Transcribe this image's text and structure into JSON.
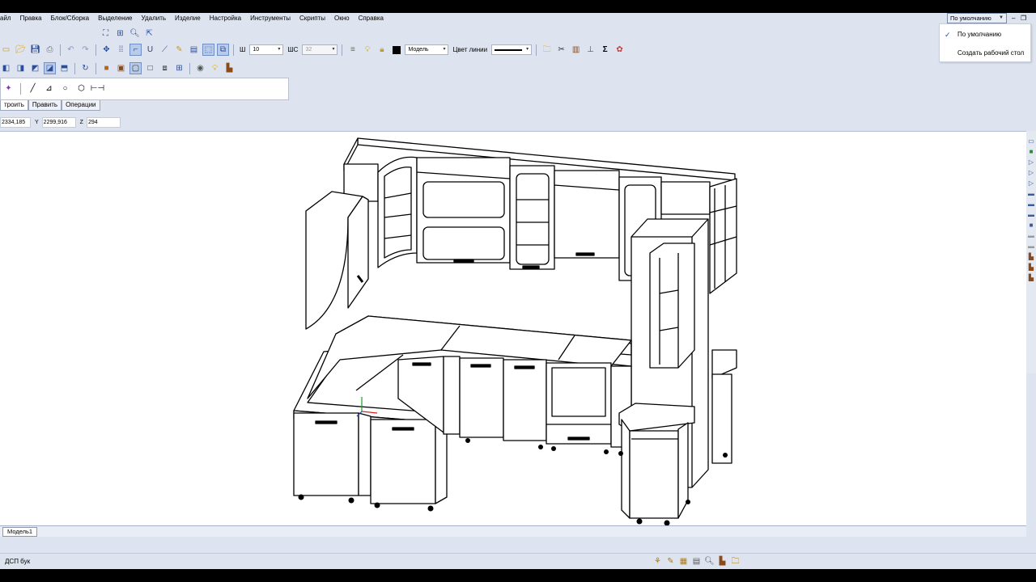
{
  "menu": [
    "айл",
    "Правка",
    "Блок/Сборка",
    "Выделение",
    "Удалить",
    "Изделие",
    "Настройка",
    "Инструменты",
    "Скрипты",
    "Окно",
    "Справка"
  ],
  "workspace": {
    "current": "По умолчанию",
    "options": [
      "По умолчанию",
      "Создать рабочий стол"
    ]
  },
  "window_controls": {
    "minimize": "–",
    "restore": "❐"
  },
  "toolbar": {
    "width_label": "Ш",
    "width_value": "10",
    "height_label": "ШС",
    "height_value": "32",
    "layer_value": "Модель",
    "line_color_label": "Цвет линии",
    "sigma": "Σ"
  },
  "tabs": [
    "троить",
    "Править",
    "Операции"
  ],
  "coords": {
    "x_value": "2334,185",
    "y_label": "Y",
    "y_value": "2299,916",
    "z_label": "Z",
    "z_value": "294"
  },
  "model_tab": "Модель1",
  "status": {
    "material": "ДСП бук"
  },
  "colors": {
    "background": "#dde3ef",
    "viewport": "#ffffff",
    "accent": "#2b4e9c"
  }
}
